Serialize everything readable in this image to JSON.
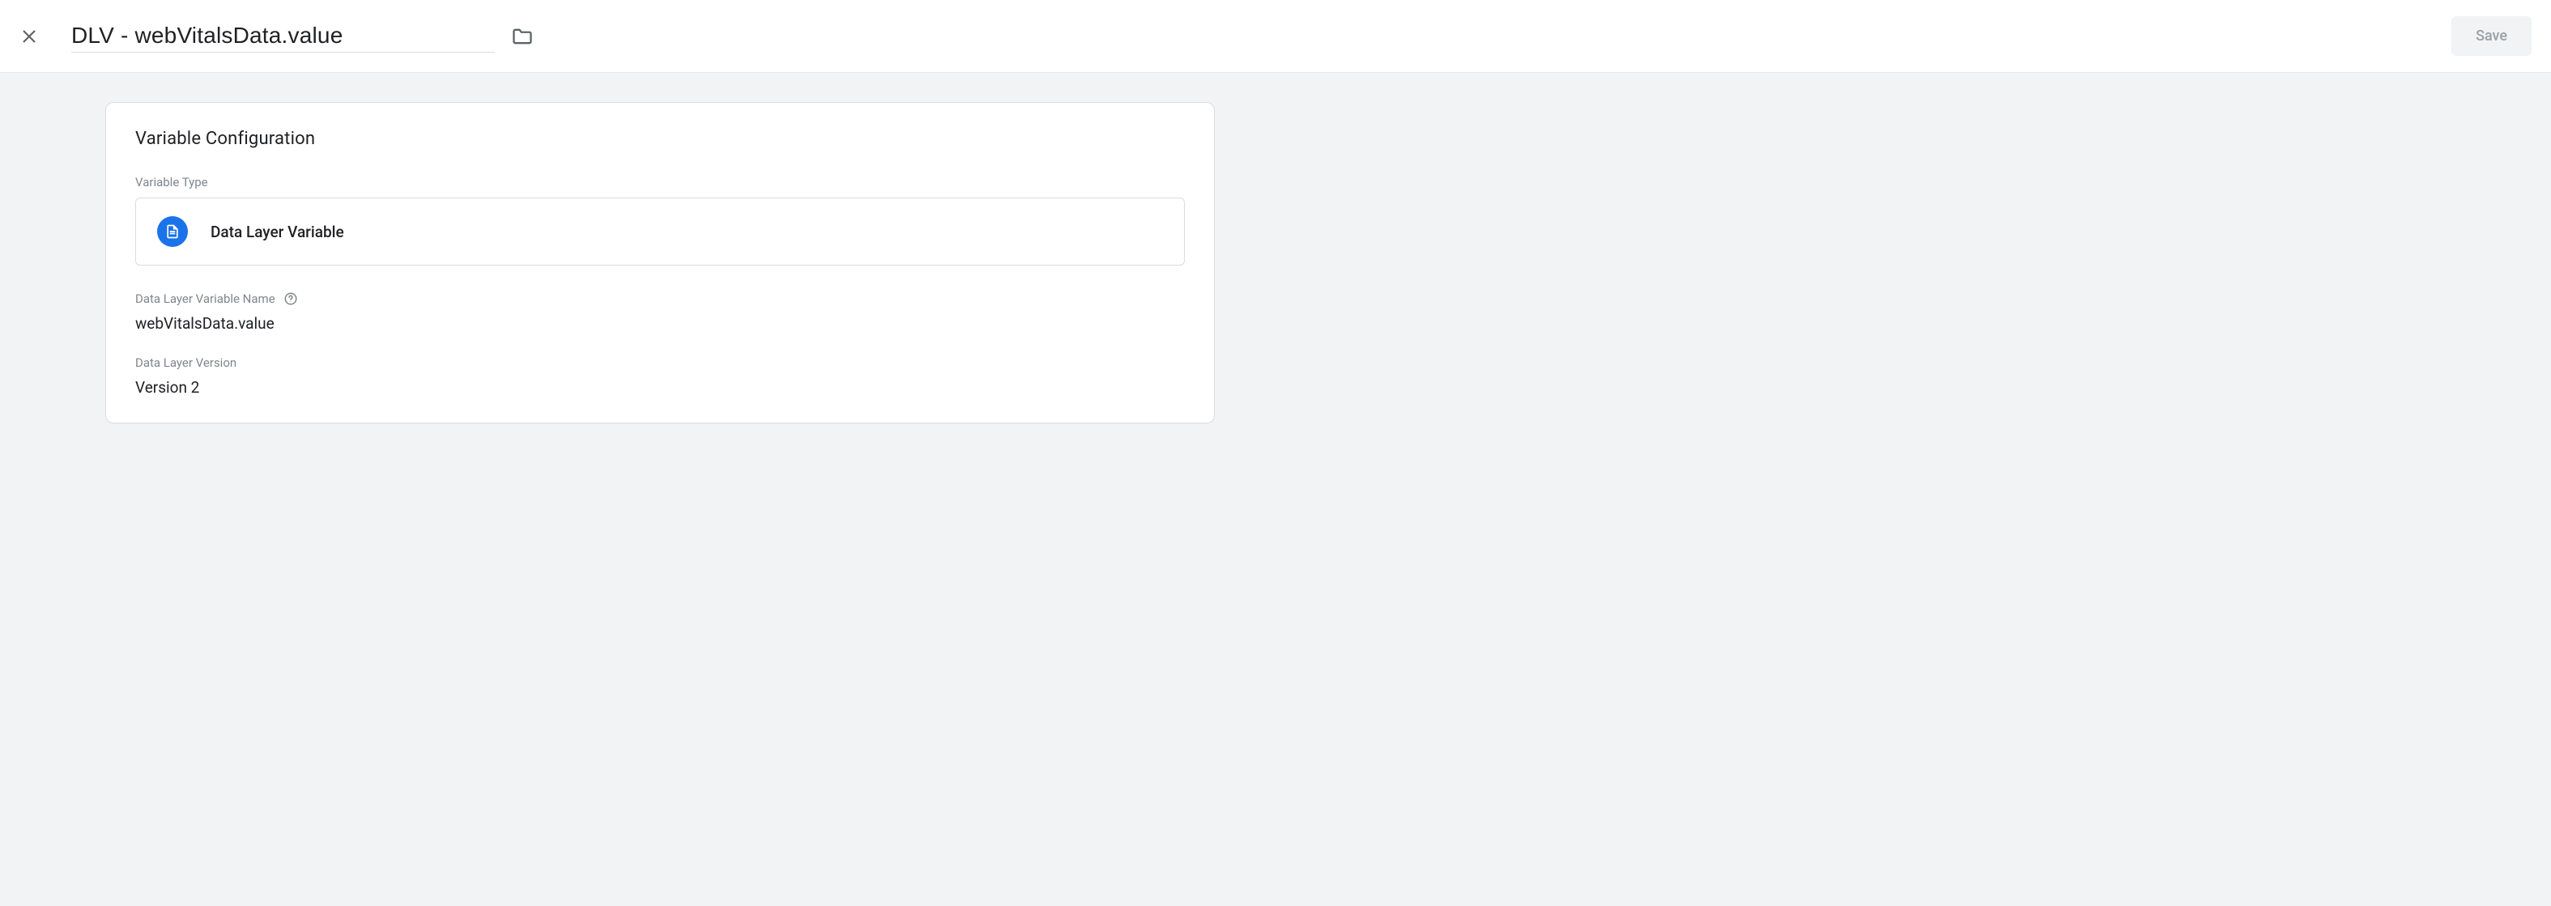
{
  "header": {
    "title": "DLV - webVitalsData.value",
    "save_label": "Save"
  },
  "card": {
    "title": "Variable Configuration",
    "variable_type_label": "Variable Type",
    "variable_type_name": "Data Layer Variable",
    "dlv_name_label": "Data Layer Variable Name",
    "dlv_name_value": "webVitalsData.value",
    "dlv_version_label": "Data Layer Version",
    "dlv_version_value": "Version 2"
  }
}
